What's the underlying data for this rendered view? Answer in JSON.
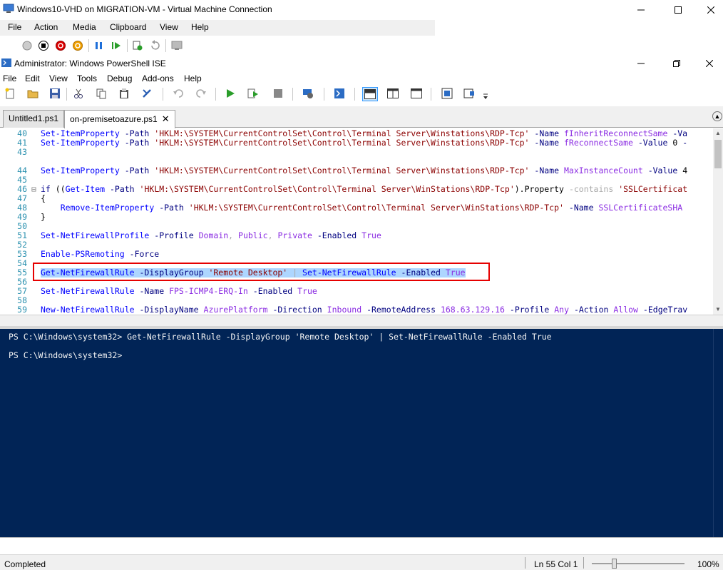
{
  "vm_window": {
    "title": "Windows10-VHD on MIGRATION-VM - Virtual Machine Connection",
    "menu": [
      "File",
      "Action",
      "Media",
      "Clipboard",
      "View",
      "Help"
    ],
    "toolbar_icons": [
      "ctrl-alt-del-icon",
      "turn-off-icon",
      "shutdown-icon",
      "power-icon",
      "pause-icon",
      "start-icon",
      "checkpoint-icon",
      "revert-icon",
      "enhanced-session-icon"
    ]
  },
  "ise_window": {
    "title": "Administrator: Windows PowerShell ISE",
    "menu": [
      "File",
      "Edit",
      "View",
      "Tools",
      "Debug",
      "Add-ons",
      "Help"
    ],
    "tabs": [
      {
        "label": "Untitled1.ps1",
        "active": false
      },
      {
        "label": "on-premisetoazure.ps1",
        "active": true
      }
    ]
  },
  "editor": {
    "lines": [
      {
        "num": "40",
        "code": "Set-ItemProperty -Path 'HKLM:\\SYSTEM\\CurrentControlSet\\Control\\Terminal Server\\Winstations\\RDP-Tcp' -Name fInheritReconnectSame -Va"
      },
      {
        "num": "41",
        "code": "Set-ItemProperty -Path 'HKLM:\\SYSTEM\\CurrentControlSet\\Control\\Terminal Server\\Winstations\\RDP-Tcp' -Name fReconnectSame -Value 0 -"
      },
      {
        "num": "43",
        "code": ""
      },
      {
        "num": "44",
        "code": "Set-ItemProperty -Path 'HKLM:\\SYSTEM\\CurrentControlSet\\Control\\Terminal Server\\Winstations\\RDP-Tcp' -Name MaxInstanceCount -Value 4"
      },
      {
        "num": "45",
        "code": ""
      },
      {
        "num": "46",
        "code": "if ((Get-Item -Path 'HKLM:\\SYSTEM\\CurrentControlSet\\Control\\Terminal Server\\WinStations\\RDP-Tcp').Property -contains 'SSLCertificat"
      },
      {
        "num": "47",
        "code": "{"
      },
      {
        "num": "48",
        "code": "    Remove-ItemProperty -Path 'HKLM:\\SYSTEM\\CurrentControlSet\\Control\\Terminal Server\\WinStations\\RDP-Tcp' -Name SSLCertificateSHA"
      },
      {
        "num": "49",
        "code": "}"
      },
      {
        "num": "50",
        "code": ""
      },
      {
        "num": "51",
        "code": "Set-NetFirewallProfile -Profile Domain, Public, Private -Enabled True"
      },
      {
        "num": "52",
        "code": ""
      },
      {
        "num": "53",
        "code": "Enable-PSRemoting -Force"
      },
      {
        "num": "54",
        "code": ""
      },
      {
        "num": "55",
        "code": "Get-NetFirewallRule -DisplayGroup 'Remote Desktop' | Set-NetFirewallRule -Enabled True"
      },
      {
        "num": "56",
        "code": ""
      },
      {
        "num": "57",
        "code": "Set-NetFirewallRule -Name FPS-ICMP4-ERQ-In -Enabled True"
      },
      {
        "num": "58",
        "code": ""
      },
      {
        "num": "59",
        "code": "New-NetFirewallRule -DisplayName AzurePlatform -Direction Inbound -RemoteAddress 168.63.129.16 -Profile Any -Action Allow -EdgeTrav"
      }
    ]
  },
  "console": {
    "lines": [
      "PS C:\\Windows\\system32> Get-NetFirewallRule -DisplayGroup 'Remote Desktop' | Set-NetFirewallRule -Enabled True",
      "",
      "PS C:\\Windows\\system32>"
    ]
  },
  "statusbar": {
    "status": "Completed",
    "position": "Ln 55  Col 1",
    "zoom": "100%"
  },
  "colors": {
    "console_bg": "#012456",
    "highlight_border": "#e60000",
    "selection": "#add6ff"
  }
}
